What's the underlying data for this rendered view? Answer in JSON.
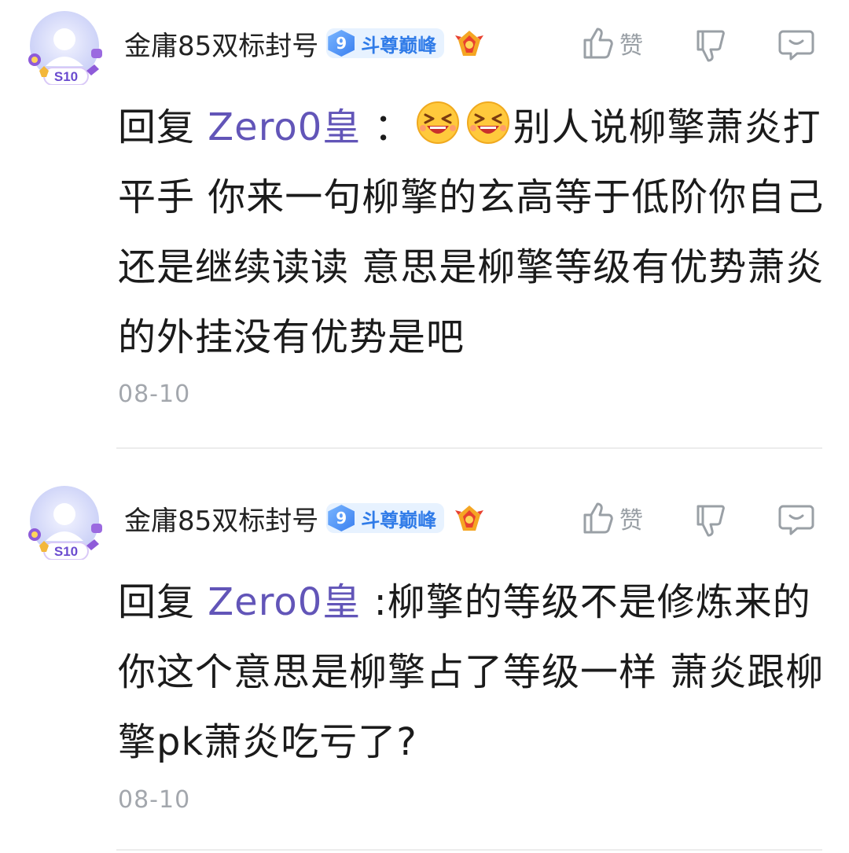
{
  "comments": [
    {
      "username": "金庸85双标封号",
      "level_number": "9",
      "level_title": "斗尊巅峰",
      "avatar_badge": "S10",
      "like_label": "赞",
      "reply_prefix": "回复",
      "reply_target": "Zero0皇",
      "separator": "：",
      "text_after_emoji": "别人说柳擎萧炎打平手 你来一句柳擎的玄高等于低阶你自己还是继续读读 意思是柳擎等级有优势萧炎的外挂没有优势是吧",
      "date": "08-10"
    },
    {
      "username": "金庸85双标封号",
      "level_number": "9",
      "level_title": "斗尊巅峰",
      "avatar_badge": "S10",
      "like_label": "赞",
      "reply_prefix": "回复",
      "reply_target": "Zero0皇",
      "separator": ":",
      "text": "柳擎的等级不是修炼来的 你这个意思是柳擎占了等级一样 萧炎跟柳擎pk萧炎吃亏了?",
      "date": "08-10"
    }
  ],
  "icons": {
    "like": "thumbs-up-icon",
    "dislike": "thumbs-down-icon",
    "reply": "comment-bubble-icon",
    "medal": "fire-medal-icon",
    "emoji": "laughing-squint-emoji"
  },
  "colors": {
    "reply_target": "#6255b8",
    "level_title": "#2f7be8",
    "date": "#a3a7ad",
    "icon_gray": "#9aa0a6"
  }
}
